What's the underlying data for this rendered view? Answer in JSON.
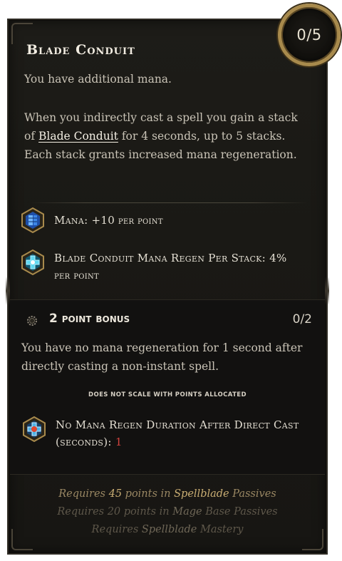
{
  "tooltip": {
    "points": "0/5",
    "title": "Blade Conduit",
    "description_1": "You have additional mana.",
    "description_2_pre": "When you indirectly cast a spell you gain a stack of ",
    "description_2_link": "Blade Conduit",
    "description_2_post": " for 4 seconds, up to 5 stacks. Each stack grants increased mana regeneration.",
    "stats": [
      {
        "icon": "mana-icon",
        "label": "Mana: +10",
        "suffix": " per point"
      },
      {
        "icon": "mana-regen-icon",
        "label": "Blade Conduit Mana Regen Per Stack: 4%",
        "suffix": "per point"
      }
    ]
  },
  "bonus": {
    "title": "2 point bonus",
    "count": "0/2",
    "description": "You have no mana regeneration for 1 second after directly casting a non-instant spell.",
    "scale_note": "Does not scale with points allocated",
    "stat_label": "No Mana Regen Duration After Direct Cast (seconds): ",
    "stat_value": "1",
    "icon": "no-regen-icon"
  },
  "requirements": [
    {
      "pre": "Requires ",
      "num": "45",
      "mid1": " points ",
      "in": "in",
      "sp": " Spellblade ",
      "tail": "Passives"
    },
    {
      "pre": "Requires 20 points ",
      "in": "in",
      "sp": " Mage ",
      "tail": "Base Passives"
    },
    {
      "pre": "Requires ",
      "sp": "Spellblade",
      "tail": " Mastery"
    }
  ],
  "colors": {
    "background": "#1a1915",
    "accent_gold": "#a88a4c",
    "value_red": "#d2433e"
  }
}
